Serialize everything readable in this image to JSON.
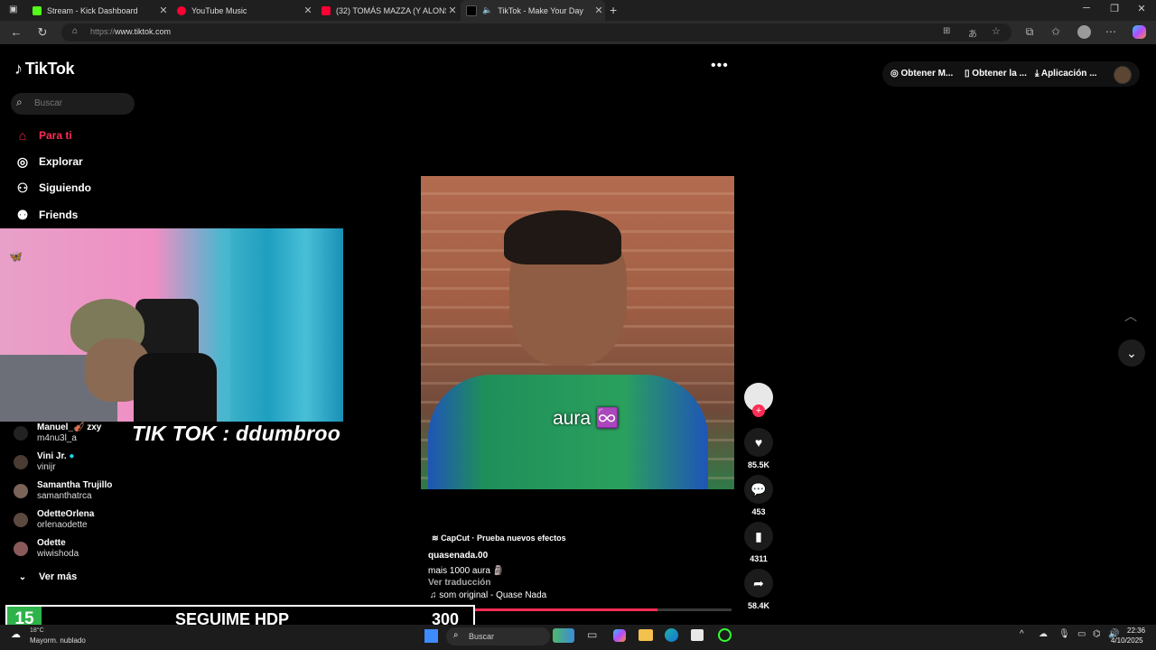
{
  "browser": {
    "tabs": [
      {
        "title": "Stream - Kick Dashboard",
        "icon": "kick-icon",
        "color": "#53fc18",
        "active": false
      },
      {
        "title": "YouTube Music",
        "icon": "youtube-music-icon",
        "color": "#ff0033",
        "active": false
      },
      {
        "title": "(32) TOMÁS MAZZA (Y ALONSO)",
        "icon": "youtube-icon",
        "color": "#ff0033",
        "active": false
      },
      {
        "title": "TikTok - Make Your Day",
        "icon": "tiktok-icon",
        "color": "#ffffff",
        "active": true
      }
    ],
    "url_prefix": "https://",
    "url_host": "www.tiktok.com"
  },
  "tiktok": {
    "logo": "TikTok",
    "search_placeholder": "Buscar",
    "nav": [
      {
        "label": "Para ti",
        "icon": "home-icon",
        "active": true
      },
      {
        "label": "Explorar",
        "icon": "compass-icon",
        "active": false
      },
      {
        "label": "Siguiendo",
        "icon": "following-icon",
        "active": false
      },
      {
        "label": "Friends",
        "icon": "friends-icon",
        "active": false
      }
    ],
    "following": [
      {
        "name": "Manuel_🎻 zxy",
        "handle": "m4nu3l_a"
      },
      {
        "name": "Vini Jr.",
        "handle": "vinijr"
      },
      {
        "name": "Samantha Trujillo",
        "handle": "samanthatrca"
      },
      {
        "name": "OdetteOrlena",
        "handle": "orlenaodette"
      },
      {
        "name": "Odette",
        "handle": "wiwishoda"
      }
    ],
    "see_more": "Ver más",
    "top_actions": [
      "Obtener M...",
      "Obtener la ...",
      "Aplicación ..."
    ],
    "video": {
      "overlay_text": "aura ♾️",
      "effect_label": "CapCut · Prueba nuevos efectos",
      "author": "quasenada.00",
      "description": "mais 1000 aura 🗿",
      "translate": "Ver traducción",
      "sound": "som original - Quase Nada",
      "progress": 0.76
    },
    "actions": {
      "likes": "85.5K",
      "comments": "453",
      "saves": "4311",
      "shares": "58.4K"
    }
  },
  "stream_overlay": {
    "tiktok_tag": "TIK TOK : ddumbroo",
    "banner_number": "15",
    "banner_text": "SEGUIME HDP",
    "banner_count": "300"
  },
  "taskbar": {
    "weather_temp": "18°C",
    "weather_desc": "Mayorm. nublado",
    "search": "Buscar",
    "time": "22:36",
    "date": "4/10/2025"
  }
}
